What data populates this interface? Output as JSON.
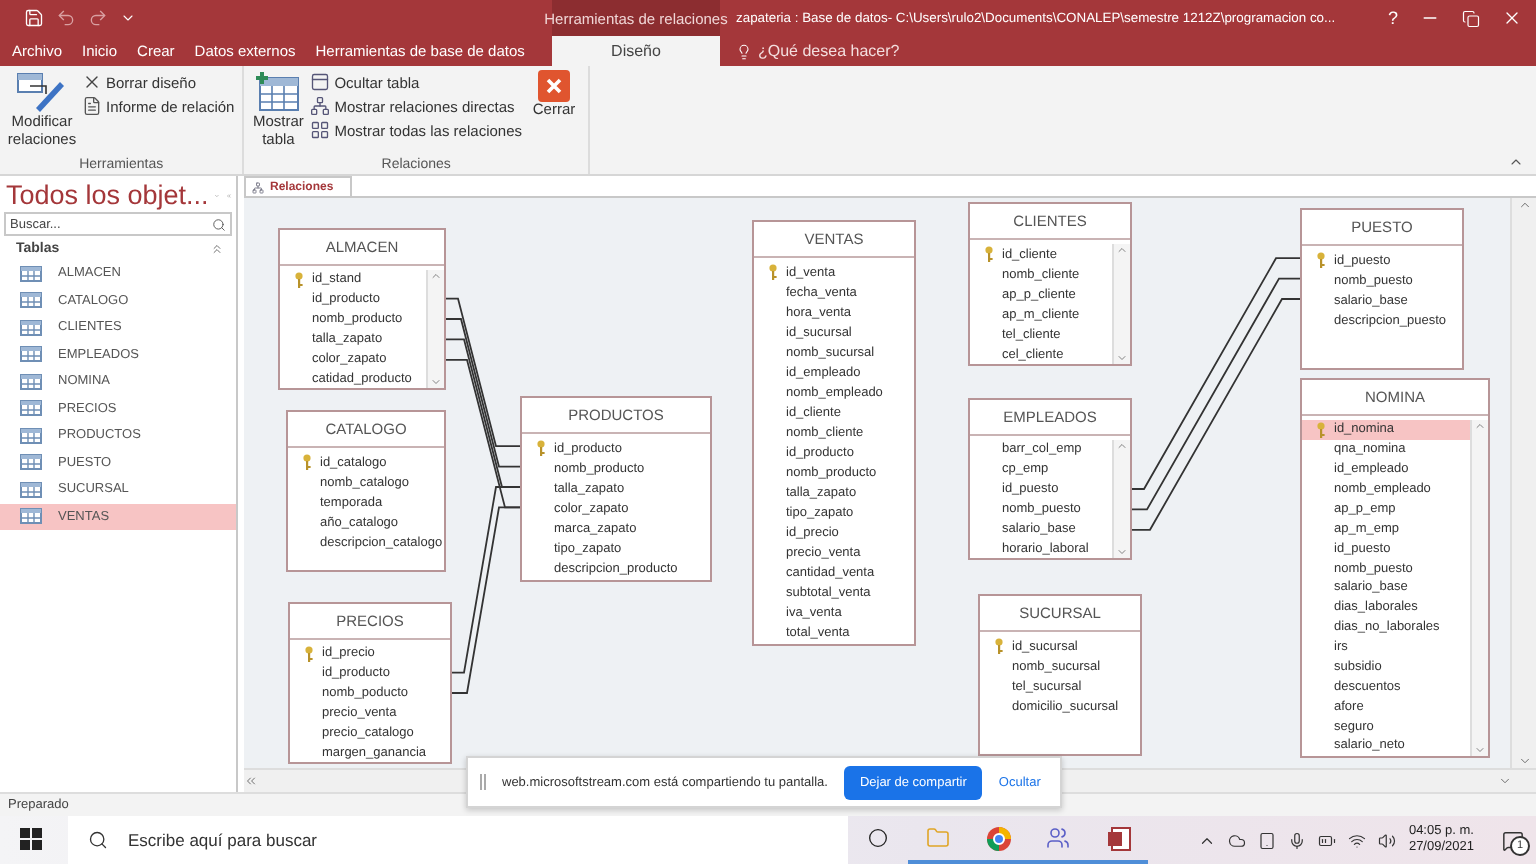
{
  "window": {
    "title": "zapateria : Base de datos- C:\\Users\\rulo2\\Documents\\CONALEP\\semestre 1212Z\\programacion co...",
    "help": "?"
  },
  "ribbon_tabs": [
    {
      "label": "Archivo",
      "selected": false
    },
    {
      "label": "Inicio",
      "selected": false
    },
    {
      "label": "Crear",
      "selected": false
    },
    {
      "label": "Datos externos",
      "selected": false
    },
    {
      "label": "Herramientas de base de datos",
      "selected": false
    }
  ],
  "context_tabs": {
    "label": "Herramientas de relaciones",
    "tabs": [
      {
        "label": "Diseño",
        "selected": true
      }
    ]
  },
  "tell_me": {
    "placeholder": "¿Qué desea hacer?"
  },
  "ribbon_groups": [
    {
      "label": "Herramientas",
      "commands": [
        {
          "label": "Modificar relaciones",
          "kind": "large"
        },
        {
          "label": "Borrar diseño",
          "kind": "small"
        },
        {
          "label": "Informe de relación",
          "kind": "small"
        }
      ]
    },
    {
      "label": "Relaciones",
      "commands": [
        {
          "label": "Mostrar tabla",
          "kind": "large"
        },
        {
          "label": "Ocultar tabla",
          "kind": "small"
        },
        {
          "label": "Mostrar relaciones directas",
          "kind": "small"
        },
        {
          "label": "Mostrar todas las relaciones",
          "kind": "small"
        },
        {
          "label": "Cerrar",
          "kind": "large"
        }
      ]
    }
  ],
  "nav": {
    "title": "Todos los objet...",
    "search": {
      "placeholder": "Buscar..."
    },
    "groups": [
      {
        "label": "Tablas",
        "expanded": true,
        "items": [
          {
            "label": "ALMACEN",
            "selected": false
          },
          {
            "label": "CATALOGO",
            "selected": false
          },
          {
            "label": "CLIENTES",
            "selected": false
          },
          {
            "label": "EMPLEADOS",
            "selected": false
          },
          {
            "label": "NOMINA",
            "selected": false
          },
          {
            "label": "PRECIOS",
            "selected": false
          },
          {
            "label": "PRODUCTOS",
            "selected": false
          },
          {
            "label": "PUESTO",
            "selected": false
          },
          {
            "label": "SUCURSAL",
            "selected": false
          },
          {
            "label": "VENTAS",
            "selected": true
          }
        ]
      }
    ]
  },
  "document_tabs": [
    {
      "label": "Relaciones",
      "selected": true
    }
  ],
  "tables": [
    {
      "name": "ALMACEN",
      "scrollbar": true,
      "fields": [
        {
          "name": "id_stand",
          "key": true,
          "selected": false
        },
        {
          "name": "id_producto",
          "key": false,
          "selected": false
        },
        {
          "name": "nomb_producto",
          "key": false,
          "selected": false
        },
        {
          "name": "talla_zapato",
          "key": false,
          "selected": false
        },
        {
          "name": "color_zapato",
          "key": false,
          "selected": false
        },
        {
          "name": "catidad_producto",
          "key": false,
          "selected": false
        }
      ]
    },
    {
      "name": "CATALOGO",
      "scrollbar": false,
      "fields": [
        {
          "name": "id_catalogo",
          "key": true,
          "selected": false
        },
        {
          "name": "nomb_catalogo",
          "key": false,
          "selected": false
        },
        {
          "name": "temporada",
          "key": false,
          "selected": false
        },
        {
          "name": "año_catalogo",
          "key": false,
          "selected": false
        },
        {
          "name": "descripcion_catalogo",
          "key": false,
          "selected": false
        }
      ]
    },
    {
      "name": "PRECIOS",
      "scrollbar": false,
      "fields": [
        {
          "name": "id_precio",
          "key": true,
          "selected": false
        },
        {
          "name": "id_producto",
          "key": false,
          "selected": false
        },
        {
          "name": "nomb_poducto",
          "key": false,
          "selected": false
        },
        {
          "name": "precio_venta",
          "key": false,
          "selected": false
        },
        {
          "name": "precio_catalogo",
          "key": false,
          "selected": false
        },
        {
          "name": "margen_ganancia",
          "key": false,
          "selected": false
        }
      ]
    },
    {
      "name": "PRODUCTOS",
      "scrollbar": false,
      "fields": [
        {
          "name": "id_producto",
          "key": true,
          "selected": false
        },
        {
          "name": "nomb_producto",
          "key": false,
          "selected": false
        },
        {
          "name": "talla_zapato",
          "key": false,
          "selected": false
        },
        {
          "name": "color_zapato",
          "key": false,
          "selected": false
        },
        {
          "name": "marca_zapato",
          "key": false,
          "selected": false
        },
        {
          "name": "tipo_zapato",
          "key": false,
          "selected": false
        },
        {
          "name": "descripcion_producto",
          "key": false,
          "selected": false
        }
      ]
    },
    {
      "name": "VENTAS",
      "scrollbar": false,
      "fields": [
        {
          "name": "id_venta",
          "key": true,
          "selected": false
        },
        {
          "name": "fecha_venta",
          "key": false,
          "selected": false
        },
        {
          "name": "hora_venta",
          "key": false,
          "selected": false
        },
        {
          "name": "id_sucursal",
          "key": false,
          "selected": false
        },
        {
          "name": "nomb_sucursal",
          "key": false,
          "selected": false
        },
        {
          "name": "id_empleado",
          "key": false,
          "selected": false
        },
        {
          "name": "nomb_empleado",
          "key": false,
          "selected": false
        },
        {
          "name": "id_cliente",
          "key": false,
          "selected": false
        },
        {
          "name": "nomb_cliente",
          "key": false,
          "selected": false
        },
        {
          "name": "id_producto",
          "key": false,
          "selected": false
        },
        {
          "name": "nomb_producto",
          "key": false,
          "selected": false
        },
        {
          "name": "talla_zapato",
          "key": false,
          "selected": false
        },
        {
          "name": "tipo_zapato",
          "key": false,
          "selected": false
        },
        {
          "name": "id_precio",
          "key": false,
          "selected": false
        },
        {
          "name": "precio_venta",
          "key": false,
          "selected": false
        },
        {
          "name": "cantidad_venta",
          "key": false,
          "selected": false
        },
        {
          "name": "subtotal_venta",
          "key": false,
          "selected": false
        },
        {
          "name": "iva_venta",
          "key": false,
          "selected": false
        },
        {
          "name": "total_venta",
          "key": false,
          "selected": false
        }
      ]
    },
    {
      "name": "CLIENTES",
      "scrollbar": true,
      "fields": [
        {
          "name": "id_cliente",
          "key": true,
          "selected": false
        },
        {
          "name": "nomb_cliente",
          "key": false,
          "selected": false
        },
        {
          "name": "ap_p_cliente",
          "key": false,
          "selected": false
        },
        {
          "name": "ap_m_cliente",
          "key": false,
          "selected": false
        },
        {
          "name": "tel_cliente",
          "key": false,
          "selected": false
        },
        {
          "name": "cel_cliente",
          "key": false,
          "selected": false
        }
      ]
    },
    {
      "name": "EMPLEADOS",
      "scrollbar": true,
      "fields": [
        {
          "name": "barr_col_emp",
          "key": false,
          "selected": false
        },
        {
          "name": "cp_emp",
          "key": false,
          "selected": false
        },
        {
          "name": "id_puesto",
          "key": false,
          "selected": false
        },
        {
          "name": "nomb_puesto",
          "key": false,
          "selected": false
        },
        {
          "name": "salario_base",
          "key": false,
          "selected": false
        },
        {
          "name": "horario_laboral",
          "key": false,
          "selected": false
        }
      ]
    },
    {
      "name": "SUCURSAL",
      "scrollbar": false,
      "fields": [
        {
          "name": "id_sucursal",
          "key": true,
          "selected": false
        },
        {
          "name": "nomb_sucursal",
          "key": false,
          "selected": false
        },
        {
          "name": "tel_sucursal",
          "key": false,
          "selected": false
        },
        {
          "name": "domicilio_sucursal",
          "key": false,
          "selected": false
        }
      ]
    },
    {
      "name": "PUESTO",
      "scrollbar": false,
      "fields": [
        {
          "name": "id_puesto",
          "key": true,
          "selected": false
        },
        {
          "name": "nomb_puesto",
          "key": false,
          "selected": false
        },
        {
          "name": "salario_base",
          "key": false,
          "selected": false
        },
        {
          "name": "descripcion_puesto",
          "key": false,
          "selected": false
        }
      ]
    },
    {
      "name": "NOMINA",
      "scrollbar": true,
      "fields": [
        {
          "name": "id_nomina",
          "key": true,
          "selected": true
        },
        {
          "name": "qna_nomina",
          "key": false,
          "selected": false
        },
        {
          "name": "id_empleado",
          "key": false,
          "selected": false
        },
        {
          "name": "nomb_empleado",
          "key": false,
          "selected": false
        },
        {
          "name": "ap_p_emp",
          "key": false,
          "selected": false
        },
        {
          "name": "ap_m_emp",
          "key": false,
          "selected": false
        },
        {
          "name": "id_puesto",
          "key": false,
          "selected": false
        },
        {
          "name": "nomb_puesto",
          "key": false,
          "selected": false
        },
        {
          "name": "salario_base",
          "key": false,
          "selected": false
        },
        {
          "name": "dias_laborales",
          "key": false,
          "selected": false
        },
        {
          "name": "dias_no_laborales",
          "key": false,
          "selected": false
        },
        {
          "name": "irs",
          "key": false,
          "selected": false
        },
        {
          "name": "subsidio",
          "key": false,
          "selected": false
        },
        {
          "name": "descuentos",
          "key": false,
          "selected": false
        },
        {
          "name": "afore",
          "key": false,
          "selected": false
        },
        {
          "name": "seguro",
          "key": false,
          "selected": false
        },
        {
          "name": "salario_neto",
          "key": false,
          "selected": false
        }
      ]
    }
  ],
  "status_bar": "Preparado",
  "share_notice": {
    "text": "web.microsoftstream.com está compartiendo tu pantalla.",
    "button": "Dejar de compartir",
    "link": "Ocultar"
  },
  "taskbar": {
    "search": {
      "placeholder": "Escribe aquí para buscar"
    },
    "time": "04:05 p. m.",
    "date": "27/09/2021",
    "notifications": "1"
  }
}
